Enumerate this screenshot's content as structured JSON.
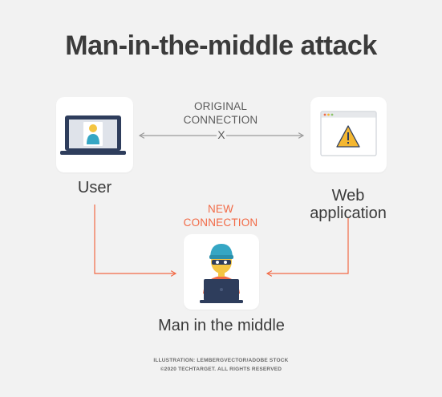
{
  "title": "Man-in-the-middle attack",
  "user": {
    "label": "User"
  },
  "web_app": {
    "label": "Web application"
  },
  "attacker": {
    "label": "Man in the middle"
  },
  "original_connection": {
    "line1": "ORIGINAL",
    "line2": "CONNECTION",
    "marker": "X"
  },
  "new_connection": {
    "line1": "NEW",
    "line2": "CONNECTION"
  },
  "credits": {
    "line1": "ILLUSTRATION: LEMBERGVECTOR/ADOBE STOCK",
    "line2": "©2020 TECHTARGET. ALL RIGHTS RESERVED"
  },
  "colors": {
    "background": "#f2f2f2",
    "accent_red": "#f26a46",
    "grey_line": "#9a9a9a",
    "laptop_navy": "#2e3d5c",
    "hat_teal": "#35a6c4",
    "warning_yellow": "#f4b731"
  },
  "icons": {
    "user": "laptop-user-icon",
    "web_app": "browser-warning-icon",
    "attacker": "hacker-laptop-icon"
  }
}
